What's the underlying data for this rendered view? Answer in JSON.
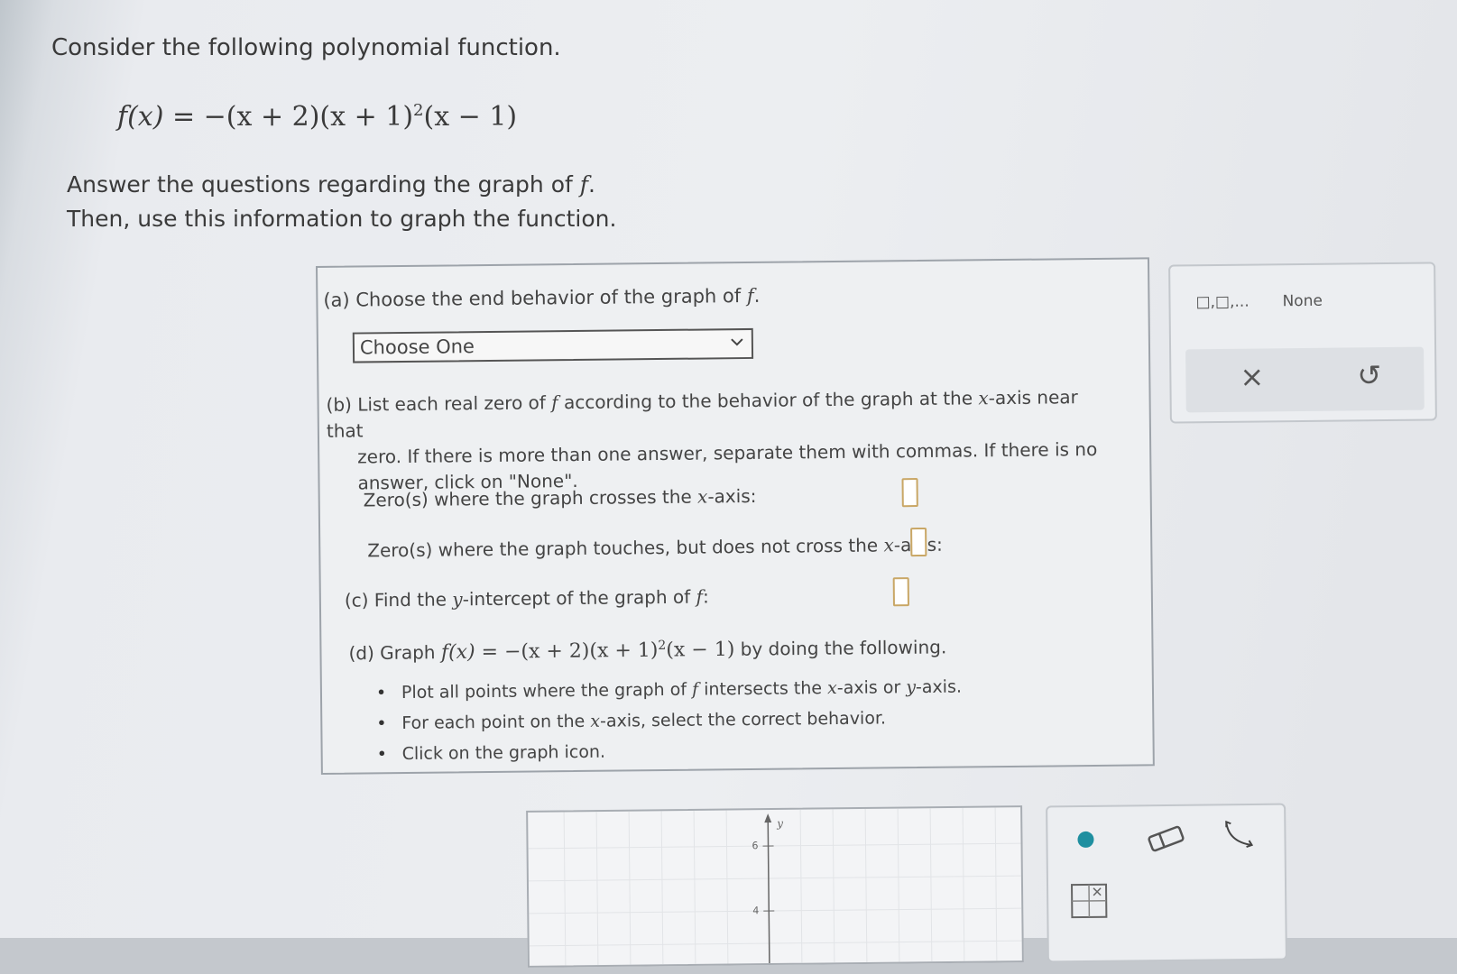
{
  "question": {
    "intro": "Consider the following polynomial function.",
    "formula_lhs": "f(x)",
    "formula_rhs": "= −(x + 2)(x + 1)",
    "formula_exp": "2",
    "formula_tail": "(x − 1)",
    "instruction_1_pre": "Answer the questions regarding the graph of",
    "instruction_f": "f",
    "instruction_1_post": ".",
    "instruction_2": "Then, use this information to graph the function."
  },
  "part_a": {
    "label_pre": "(a) Choose the end behavior of the graph of",
    "label_f": "f",
    "label_post": ".",
    "dropdown_value": "Choose One"
  },
  "part_b": {
    "line1_pre": "(b) List each real zero of",
    "line1_f": "f",
    "line1_mid": "according to the behavior of the graph at the",
    "line1_x": "x",
    "line1_post": "-axis near that",
    "line2": "zero. If there is more than one answer, separate them with commas. If there is no",
    "line3": "answer, click on \"None\".",
    "crosses_pre": "Zero(s) where the graph crosses the",
    "crosses_x": "x",
    "crosses_post": "-axis:",
    "touches_pre": "Zero(s) where the graph touches, but does not cross the",
    "touches_x": "x",
    "touches_post": "-axis:"
  },
  "part_c": {
    "label_pre": "(c) Find the",
    "label_y": "y",
    "label_mid": "-intercept of the graph of",
    "label_f": "f",
    "label_post": ":"
  },
  "part_d": {
    "label_pre": "(d) Graph",
    "formula_lhs": "f(x)",
    "formula_rhs": " = −(x + 2)(x + 1)",
    "formula_exp": "2",
    "formula_tail": "(x − 1)",
    "label_post": "by doing the following.",
    "bullet1_pre": "Plot all points where the graph of",
    "bullet1_f": "f",
    "bullet1_mid": "intersects the",
    "bullet1_x": "x",
    "bullet1_or": "-axis or",
    "bullet1_y": "y",
    "bullet1_post": "-axis.",
    "bullet2_pre": "For each point on the",
    "bullet2_x": "x",
    "bullet2_post": "-axis, select the correct behavior.",
    "bullet3": "Click on the graph icon."
  },
  "toolbox": {
    "list_icon_label": "□,□,...",
    "none_label": "None",
    "clear_icon": "×",
    "undo_icon": "↺"
  },
  "graph": {
    "y_axis_label": "y",
    "tick_6": "6",
    "tick_4": "4"
  },
  "colors": {
    "accent_dot": "#1f8fa0",
    "answer_box_border": "#c9a766"
  }
}
